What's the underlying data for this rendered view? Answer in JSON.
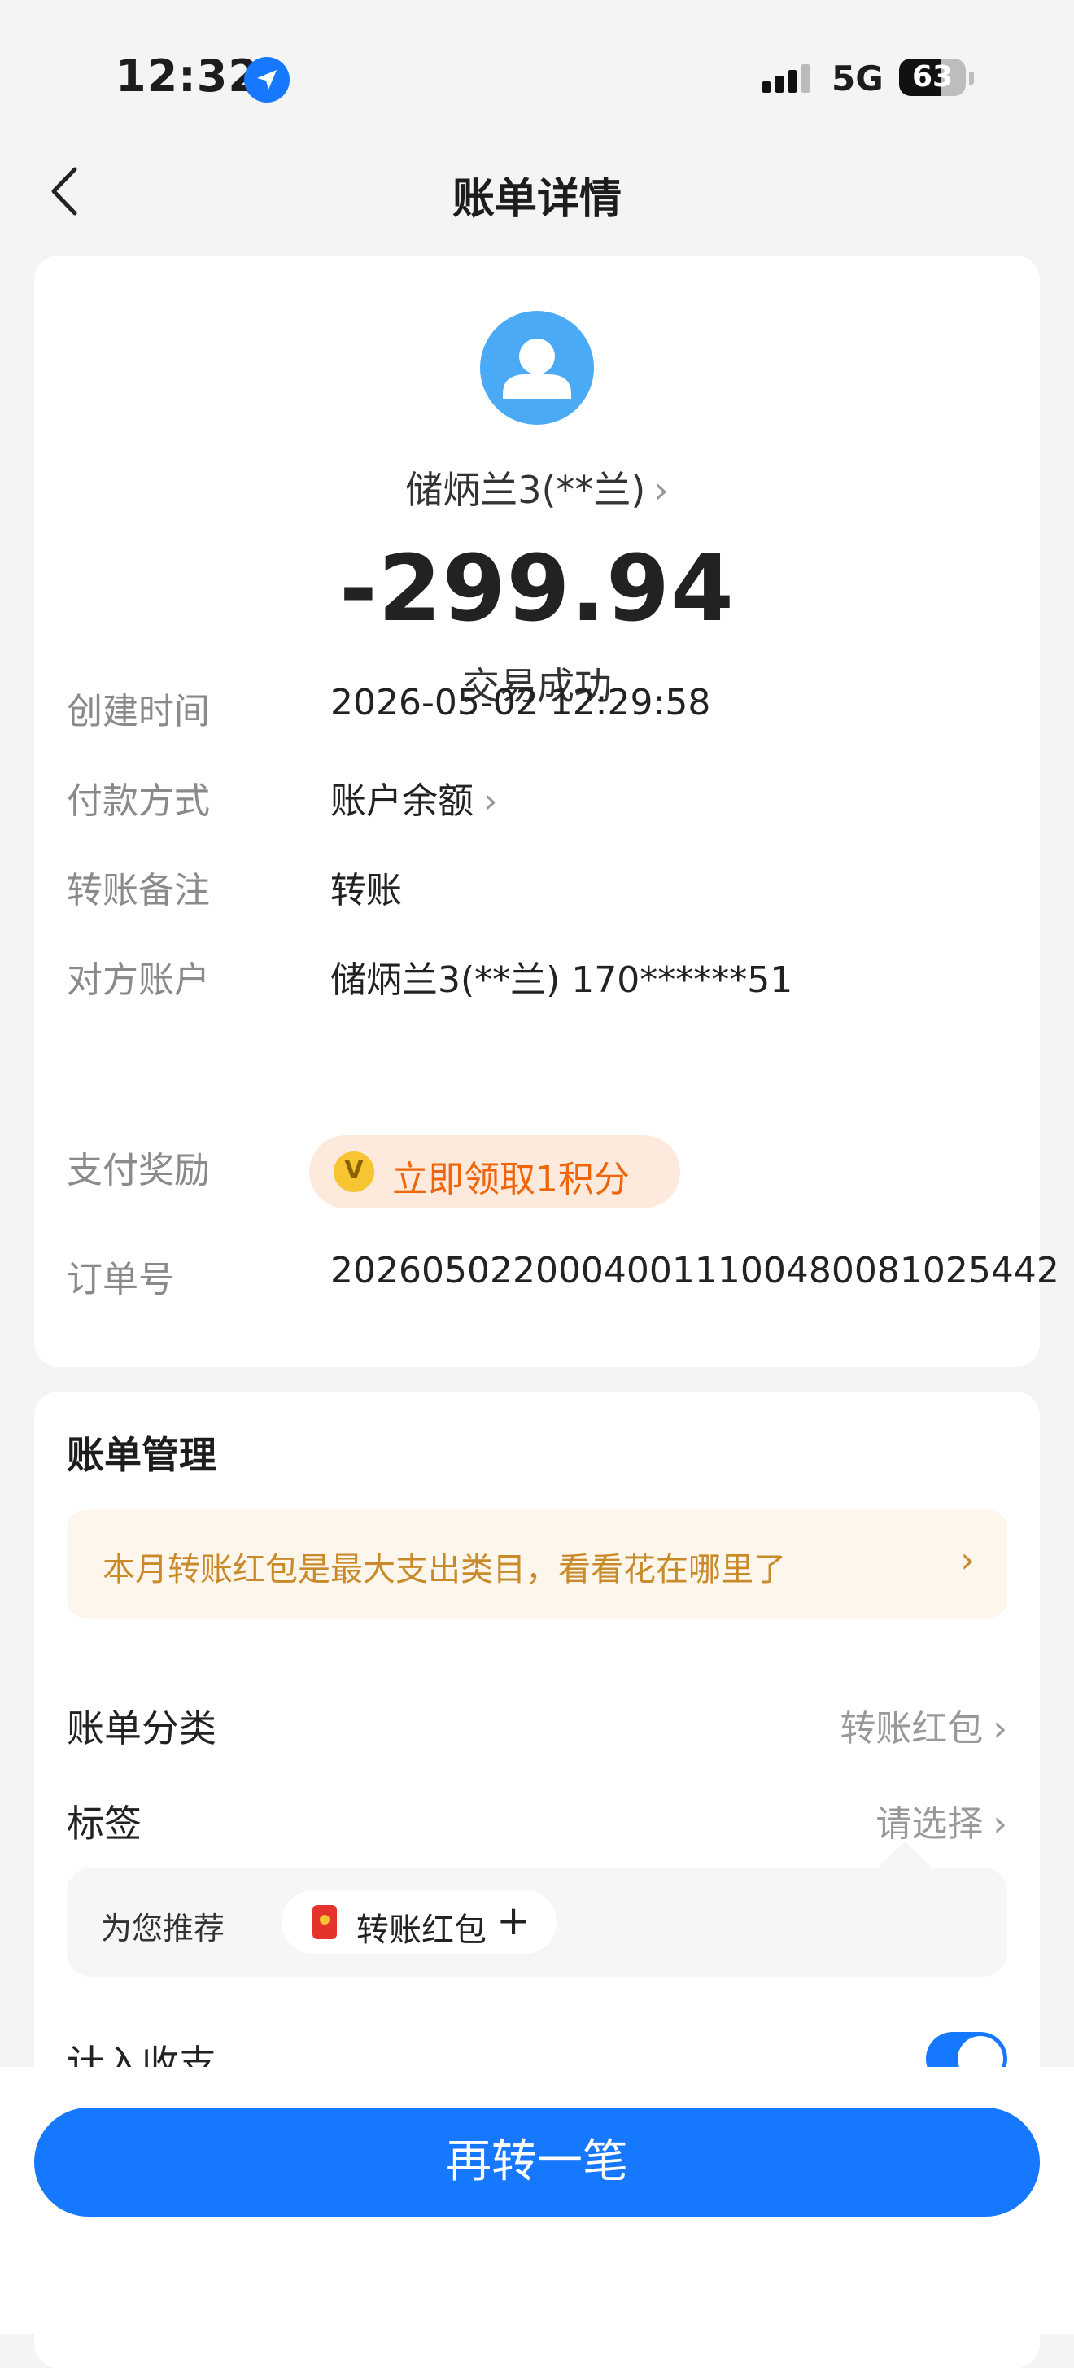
{
  "status_bar": {
    "time": "12:32",
    "network": "5G",
    "battery_level": "63",
    "battery_fraction": 0.63,
    "icons": [
      "location-arrow-icon",
      "signal-icon",
      "battery-icon"
    ]
  },
  "nav": {
    "title": "账单详情",
    "back_icon": "chevron-left-icon"
  },
  "transaction": {
    "payee": "储炳兰3(**兰)",
    "amount": "-299.94",
    "status": "交易成功",
    "avatar_icon": "user-avatar-icon",
    "avatar_color": "#4aaaf5"
  },
  "details": {
    "created_label": "创建时间",
    "created_value": "2026-05-02 12:29:58",
    "payment_label": "付款方式",
    "payment_value": "账户余额",
    "memo_label": "转账备注",
    "memo_value": "转账",
    "counterparty_label": "对方账户",
    "counterparty_value": "储炳兰3(**兰) 170******51",
    "reward_label": "支付奖励",
    "reward_value": "立即领取1积分",
    "reward_coin_text": "V",
    "order_label": "订单号",
    "order_value": "20260502200040011100480081025442"
  },
  "management": {
    "title": "账单管理",
    "tip": "本月转账红包是最大支出类目，看看花在哪里了",
    "category_label": "账单分类",
    "category_value": "转账红包",
    "tag_label": "标签",
    "tag_value": "请选择",
    "recommend_label": "为您推荐",
    "recommend_chip": "转账红包",
    "recommend_plus": "+",
    "include_label": "计入收支",
    "include_enabled": true
  },
  "cta": {
    "label": "再转一笔"
  },
  "colors": {
    "accent": "#1677ff",
    "reward_text": "#f0650a",
    "tip_text": "#c98a2a"
  }
}
